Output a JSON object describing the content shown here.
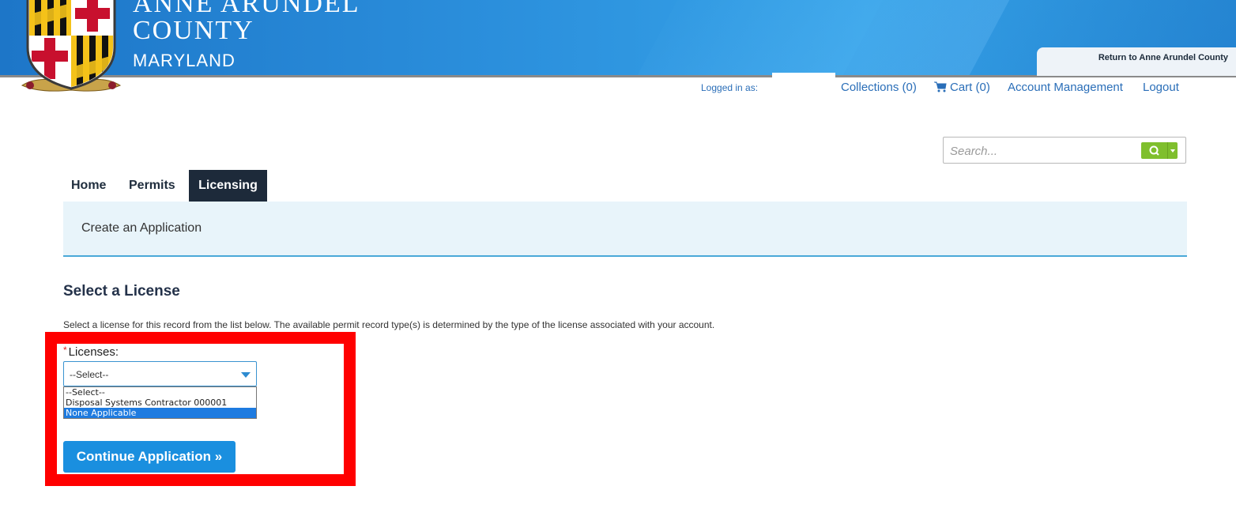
{
  "header": {
    "county_line1": "ANNE ARUNDEL",
    "county_line2": "COUNTY",
    "state": "MARYLAND",
    "return_link": "Return to Anne Arundel County",
    "brand_color": "#2b8fdc"
  },
  "account": {
    "logged_in_label": "Logged in as:",
    "collections": "Collections (0)",
    "cart": "Cart (0)",
    "account_management": "Account Management",
    "logout": "Logout",
    "cart_icon": "cart-icon"
  },
  "search": {
    "placeholder": "Search...",
    "button_icon": "magnifier-icon",
    "accent_color": "#7fbf2d"
  },
  "nav": {
    "tabs": [
      {
        "label": "Home",
        "active": false
      },
      {
        "label": "Permits",
        "active": false
      },
      {
        "label": "Licensing",
        "active": true
      }
    ]
  },
  "breadcrumb": {
    "title": "Create an Application"
  },
  "content": {
    "heading": "Select a License",
    "instructions": "Select a license for this record from the list below. The available permit record type(s) is determined by the type of the license associated with your account.",
    "licenses_label": "Licenses:",
    "required_marker": "*",
    "selected_value": "--Select--",
    "options": [
      "--Select--",
      "Disposal Systems Contractor 000001",
      "None Applicable"
    ],
    "highlighted_option": "None Applicable",
    "continue_button": "Continue Application »"
  }
}
